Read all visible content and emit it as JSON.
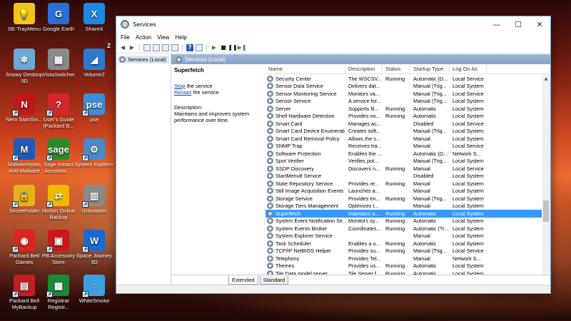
{
  "desktop": {
    "icons": [
      {
        "label": "SE-TrayMenu",
        "color": "#f2c318",
        "glyph": "💡"
      },
      {
        "label": "Google Earth",
        "color": "#2a6fd6",
        "glyph": "G"
      },
      {
        "label": "ShareX",
        "color": "#1e88e5",
        "glyph": "X"
      },
      {
        "label": "Snowy Desktop 3D",
        "color": "#6aa8d8",
        "glyph": "❄"
      },
      {
        "label": "VistaSwitcher",
        "color": "#8a8a8a",
        "glyph": "▦"
      },
      {
        "label": "VolumeZ",
        "color": "#2a7ad0",
        "glyph": "◢"
      },
      {
        "label": "Nero StartSm...",
        "color": "#c0181a",
        "glyph": "N"
      },
      {
        "label": "User's Guide (Packard B...",
        "color": "#d3262a",
        "glyph": "?"
      },
      {
        "label": "pse",
        "color": "#3a8fd8",
        "glyph": "pse"
      },
      {
        "label": "Malwarebytes Anti-Malware",
        "color": "#1e5ab8",
        "glyph": "M"
      },
      {
        "label": "Sage Instant Accounts ...",
        "color": "#2a8a2a",
        "glyph": "sage"
      },
      {
        "label": "System Explorer",
        "color": "#4a8ac8",
        "glyph": "⚙"
      },
      {
        "label": "SecretFolder",
        "color": "#e6b21c",
        "glyph": "🔒"
      },
      {
        "label": "Norton Online Backup",
        "color": "#f0b800",
        "glyph": "⇄"
      },
      {
        "label": "Uninstaller",
        "color": "#8a8a8a",
        "glyph": "▥"
      },
      {
        "label": "Packard Bell Games",
        "color": "#d8251f",
        "glyph": "◉"
      },
      {
        "label": "PB Accessory Store",
        "color": "#c81818",
        "glyph": "▣"
      },
      {
        "label": "Space Journey 3D",
        "color": "#1a6ad0",
        "glyph": "W"
      },
      {
        "label": "Packard Bell MyBackup",
        "color": "#c02020",
        "glyph": "▤"
      },
      {
        "label": "Registrar Registr...",
        "color": "#1a8a3a",
        "glyph": "▦"
      },
      {
        "label": "WhiteSmoke",
        "color": "#3aa0e0",
        "glyph": "◌"
      }
    ],
    "volume_badge": "2"
  },
  "window": {
    "title": "Services",
    "controls": {
      "minimize": "—",
      "maximize": "☐",
      "close": "✕"
    },
    "menu": [
      "File",
      "Action",
      "View",
      "Help"
    ],
    "tree_item": "Services (Local)",
    "panel_title": "Services (Local)",
    "detail": {
      "service_name": "Superfetch",
      "stop_link": "Stop",
      "stop_rest": " the service",
      "restart_link": "Restart",
      "restart_rest": " the service",
      "description_label": "Description:",
      "description_text": "Maintains and improves system performance over time."
    },
    "columns": [
      "Name",
      "Description",
      "Status",
      "Startup Type",
      "Log On As"
    ],
    "rows": [
      {
        "name": "Security Center",
        "desc": "The WSCSV...",
        "status": "Running",
        "startup": "Automatic (D...",
        "logon": "Local Service"
      },
      {
        "name": "Sensor Data Service",
        "desc": "Delivers dat...",
        "status": "",
        "startup": "Manual (Trig...",
        "logon": "Local System"
      },
      {
        "name": "Sensor Monitoring Service",
        "desc": "Monitors va...",
        "status": "",
        "startup": "Manual (Trig...",
        "logon": "Local Service"
      },
      {
        "name": "Sensor Service",
        "desc": "A service for...",
        "status": "",
        "startup": "Manual (Trig...",
        "logon": "Local System"
      },
      {
        "name": "Server",
        "desc": "Supports fil...",
        "status": "Running",
        "startup": "Automatic",
        "logon": "Local System"
      },
      {
        "name": "Shell Hardware Detection",
        "desc": "Provides no...",
        "status": "Running",
        "startup": "Automatic",
        "logon": "Local System"
      },
      {
        "name": "Smart Card",
        "desc": "Manages ac...",
        "status": "",
        "startup": "Disabled",
        "logon": "Local Service"
      },
      {
        "name": "Smart Card Device Enumerati...",
        "desc": "Creates soft...",
        "status": "",
        "startup": "Manual (Trig...",
        "logon": "Local System"
      },
      {
        "name": "Smart Card Removal Policy",
        "desc": "Allows the s...",
        "status": "",
        "startup": "Manual",
        "logon": "Local System"
      },
      {
        "name": "SNMP Trap",
        "desc": "Receives tra...",
        "status": "",
        "startup": "Manual",
        "logon": "Local Service"
      },
      {
        "name": "Software Protection",
        "desc": "Enables the ...",
        "status": "",
        "startup": "Automatic (D...",
        "logon": "Network S..."
      },
      {
        "name": "Spot Verifier",
        "desc": "Verifies pot...",
        "status": "",
        "startup": "Manual (Trig...",
        "logon": "Local System"
      },
      {
        "name": "SSDP Discovery",
        "desc": "Discovers n...",
        "status": "Running",
        "startup": "Manual",
        "logon": "Local Service"
      },
      {
        "name": "StartMenu8 Service",
        "desc": "",
        "status": "",
        "startup": "Disabled",
        "logon": "Local System"
      },
      {
        "name": "State Repository Service",
        "desc": "Provides re...",
        "status": "Running",
        "startup": "Manual",
        "logon": "Local System"
      },
      {
        "name": "Still Image Acquisition Events",
        "desc": "Launches a...",
        "status": "",
        "startup": "Manual",
        "logon": "Local System"
      },
      {
        "name": "Storage Service",
        "desc": "Provides en...",
        "status": "Running",
        "startup": "Manual (Trig...",
        "logon": "Local System"
      },
      {
        "name": "Storage Tiers Management",
        "desc": "Optimizes t...",
        "status": "",
        "startup": "Manual",
        "logon": "Local System"
      },
      {
        "name": "Superfetch",
        "desc": "Maintains a...",
        "status": "Running",
        "startup": "Automatic",
        "logon": "Local System",
        "selected": true
      },
      {
        "name": "System Event Notification Se...",
        "desc": "Monitors sy...",
        "status": "Running",
        "startup": "Automatic",
        "logon": "Local System"
      },
      {
        "name": "System Events Broker",
        "desc": "Coordinates...",
        "status": "Running",
        "startup": "Automatic (Tr...",
        "logon": "Local System"
      },
      {
        "name": "System Explorer Service",
        "desc": "",
        "status": "",
        "startup": "Manual",
        "logon": "Local System"
      },
      {
        "name": "Task Scheduler",
        "desc": "Enables a u...",
        "status": "Running",
        "startup": "Automatic",
        "logon": "Local System"
      },
      {
        "name": "TCP/IP NetBIOS Helper",
        "desc": "Provides su...",
        "status": "Running",
        "startup": "Manual (Trig...",
        "logon": "Local Service"
      },
      {
        "name": "Telephony",
        "desc": "Provides Tel...",
        "status": "",
        "startup": "Manual",
        "logon": "Network S..."
      },
      {
        "name": "Themes",
        "desc": "Provides us...",
        "status": "Running",
        "startup": "Automatic",
        "logon": "Local System"
      },
      {
        "name": "Tile Data model server",
        "desc": "Tile Server f...",
        "status": "Running",
        "startup": "Automatic",
        "logon": "Local System"
      }
    ],
    "tabs": [
      "Extended",
      "Standard"
    ]
  }
}
